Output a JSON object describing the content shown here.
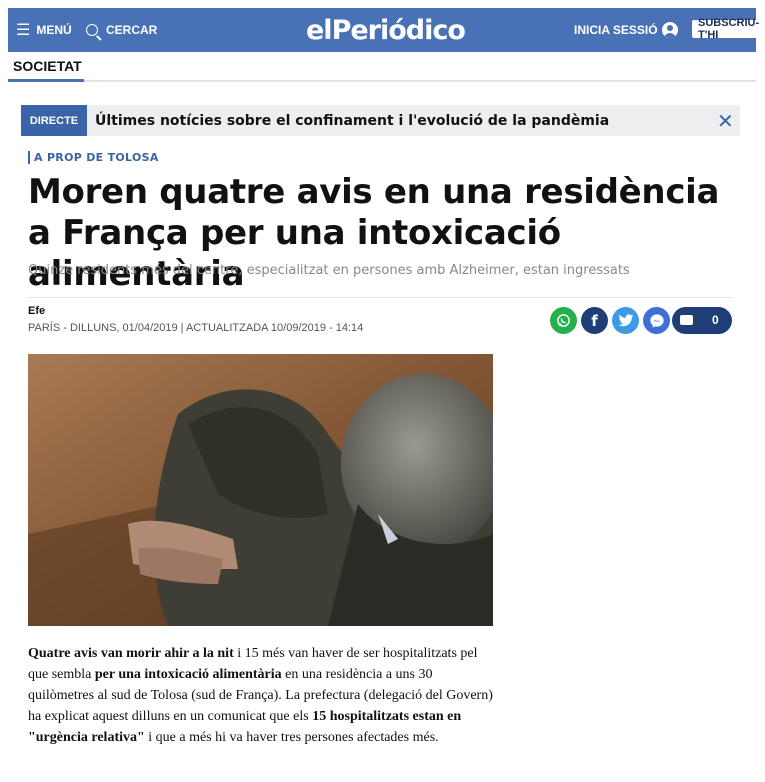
{
  "top_strip": {
    "text": "ellipse"
  },
  "header": {
    "menu_label": "MENÚ",
    "menu_icon": "hamburger-icon",
    "search_label": "CERCAR",
    "search_icon": "search-icon",
    "logo": "elPeriódico",
    "login_label": "INICIA SESSIÓ",
    "login_icon": "user-icon",
    "subscribe_label": "SUBSCRIU-T'HI",
    "bg_color": "#4872b5"
  },
  "section": {
    "label": "SOCIETAT"
  },
  "live_bar": {
    "tag": "DIRECTE",
    "text": "Últimes notícies sobre el confinament i l'evolució de la pandèmia",
    "close_icon": "close-icon"
  },
  "article": {
    "kicker": "A PROP DE TOLOSA",
    "title": "Moren quatre avis en una residència a França per una intoxicació alimentària",
    "subtitle": "Quinze residents més del centre, especialitzat en persones amb Alzheimer, estan ingressats",
    "author": "Efe",
    "dateline": "PARÍS - DILLUNS, 01/04/2019 | ACTUALITZADA 10/09/2019 - 14:14",
    "share_icons": [
      "whatsapp-icon",
      "facebook-icon",
      "twitter-icon",
      "messenger-icon"
    ],
    "comments_icon": "comment-icon",
    "comments_count": "0",
    "body": {
      "b1": "Quatre avis van morir ahir a la nit",
      "t1": " i 15 més van haver de ser hospitalitzats pel que sembla ",
      "b2": "per una intoxicació alimentària",
      "t2": " en una residència a uns 30 quilòmetres al sud de Tolosa (sud de França). La prefectura (delegació del Govern) ha explicat aquest dilluns en un comunicat que els ",
      "b3": "15 hospitalitzats estan en \"urgència relativa\"",
      "t3": " i que a més hi va haver tres persones afectades més."
    }
  }
}
